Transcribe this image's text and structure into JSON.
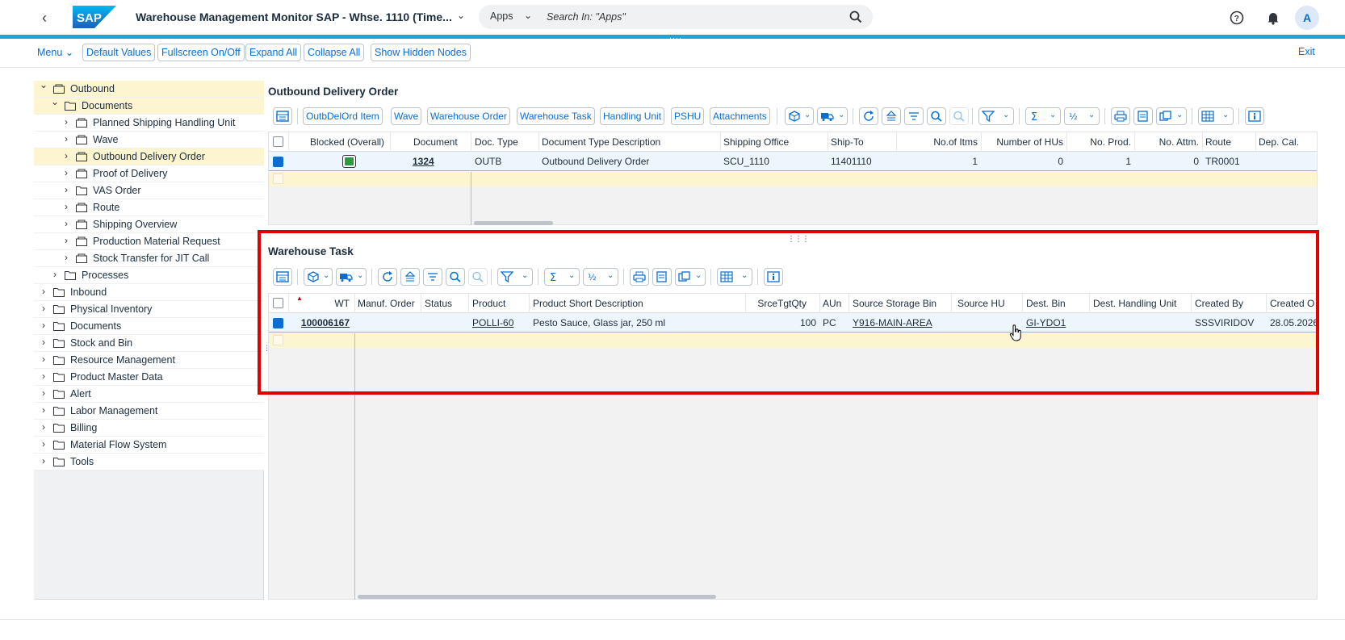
{
  "shell": {
    "title": "Warehouse Management Monitor SAP - Whse. 1110 (Time...",
    "search_scope": "Apps",
    "search_placeholder": "Search In: \"Apps\"",
    "avatar_initial": "A",
    "logo_text": "SAP"
  },
  "toolbar": {
    "menu": "Menu",
    "buttons": [
      "Default Values",
      "Fullscreen On/Off",
      "Expand All",
      "Collapse All",
      "Show Hidden Nodes"
    ],
    "exit": "Exit"
  },
  "tree": {
    "items": [
      {
        "label": "Outbound"
      },
      {
        "label": "Documents"
      },
      {
        "label": "Planned Shipping Handling Unit"
      },
      {
        "label": "Wave"
      },
      {
        "label": "Outbound Delivery Order"
      },
      {
        "label": "Proof of Delivery"
      },
      {
        "label": "VAS Order"
      },
      {
        "label": "Route"
      },
      {
        "label": "Shipping Overview"
      },
      {
        "label": "Production Material Request"
      },
      {
        "label": "Stock Transfer for JIT Call"
      },
      {
        "label": "Processes"
      },
      {
        "label": "Inbound"
      },
      {
        "label": "Physical Inventory"
      },
      {
        "label": "Documents"
      },
      {
        "label": "Stock and Bin"
      },
      {
        "label": "Resource Management"
      },
      {
        "label": "Product Master Data"
      },
      {
        "label": "Alert"
      },
      {
        "label": "Labor Management"
      },
      {
        "label": "Billing"
      },
      {
        "label": "Material Flow System"
      },
      {
        "label": "Tools"
      }
    ]
  },
  "odo": {
    "title": "Outbound Delivery Order",
    "buttons": [
      "OutbDelOrd Item",
      "Wave",
      "Warehouse Order",
      "Warehouse Task",
      "Handling Unit",
      "PSHU",
      "Attachments"
    ],
    "columns": [
      "Blocked (Overall)",
      "Document",
      "Doc. Type",
      "Document Type Description",
      "Shipping Office",
      "Ship-To",
      "No.of Itms",
      "Number of HUs",
      "No. Prod.",
      "No. Attm.",
      "Route",
      "Dep. Cal."
    ],
    "row": {
      "document": "1324",
      "doc_type": "OUTB",
      "description": "Outbound Delivery Order",
      "shipping_office": "SCU_1110",
      "ship_to": "11401110",
      "no_items": "1",
      "no_hus": "0",
      "no_prod": "1",
      "no_attm": "0",
      "route": "TR0001",
      "dep_cal": ""
    }
  },
  "wt": {
    "title": "Warehouse Task",
    "columns": [
      "WT",
      "Manuf. Order",
      "Status",
      "Product",
      "Product Short Description",
      "SrceTgtQty",
      "AUn",
      "Source Storage Bin",
      "Source HU",
      "Dest. Bin",
      "Dest. Handling Unit",
      "Created By",
      "Created O"
    ],
    "row": {
      "wt": "100006167",
      "manuf_order": "",
      "status": "",
      "product": "POLLI-60",
      "description": "Pesto Sauce, Glass jar, 250 ml",
      "qty": "100",
      "aun": "PC",
      "source_bin": "Y916-MAIN-AREA",
      "source_hu": "",
      "dest_bin": "GI-YDO1",
      "dest_hu": "",
      "created_by": "SSSVIRIDOV",
      "created_on": "28.05.2026"
    }
  },
  "colors": {
    "shell_line": "#1fa3d9",
    "highlight": "#e00000",
    "link": "#0a6ed1",
    "selected_row": "#fdf5cf"
  }
}
